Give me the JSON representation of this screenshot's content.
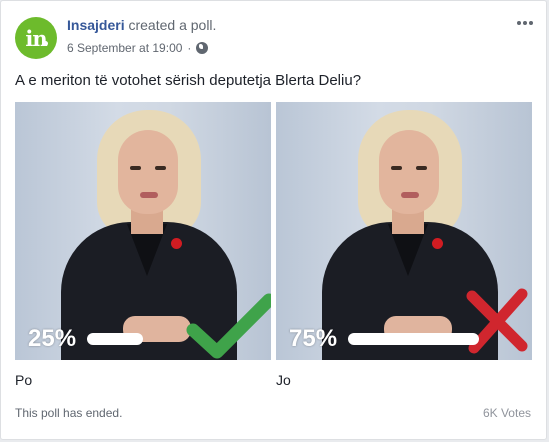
{
  "post": {
    "avatar_text": "in",
    "page_name": "Insajderi",
    "action": "created a poll.",
    "timestamp": "6 September at 19:00",
    "audience_icon": "globe-icon",
    "more_icon": "more-options-icon",
    "question": "A e meriton të votohet sërish deputetja Blerta Deliu?"
  },
  "poll": {
    "options": [
      {
        "label": "Po",
        "percent_text": "25%",
        "percent": 25,
        "mark": "checkmark-icon"
      },
      {
        "label": "Jo",
        "percent_text": "75%",
        "percent": 75,
        "mark": "cross-icon"
      }
    ],
    "status": "This poll has ended.",
    "votes": "6K Votes"
  },
  "colors": {
    "brand_green": "#6dbb2c",
    "link_blue": "#365899",
    "check_green": "#3fa34a",
    "cross_red": "#d0262e"
  }
}
